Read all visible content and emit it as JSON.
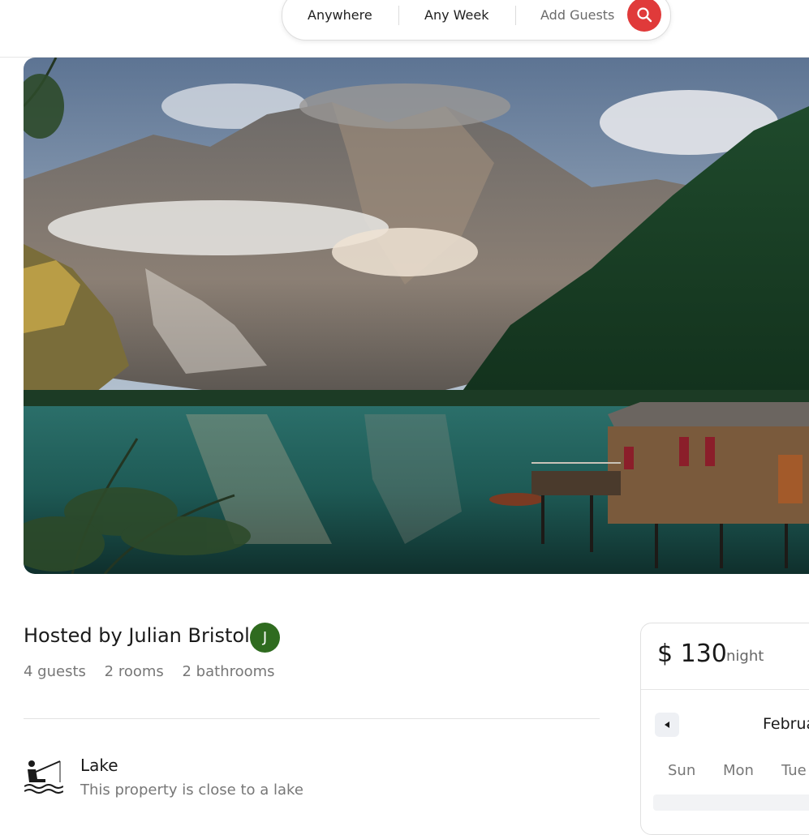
{
  "search": {
    "location": "Anywhere",
    "week": "Any Week",
    "guests": "Add Guests",
    "button_icon": "search-icon",
    "button_color": "#e03a3a"
  },
  "listing": {
    "host_title": "Hosted by Julian Bristol",
    "host_initial": "J",
    "avatar_color": "#2f6b1f",
    "stats": {
      "guests": "4 guests",
      "rooms": "2 rooms",
      "bathrooms": "2 bathrooms"
    },
    "features": [
      {
        "icon": "fishing-icon",
        "title": "Lake",
        "description": "This property is close to a lake"
      }
    ]
  },
  "booking": {
    "price": "$ 130",
    "unit": "night",
    "month": "Februa",
    "weekdays": [
      "Sun",
      "Mon",
      "Tue"
    ]
  }
}
